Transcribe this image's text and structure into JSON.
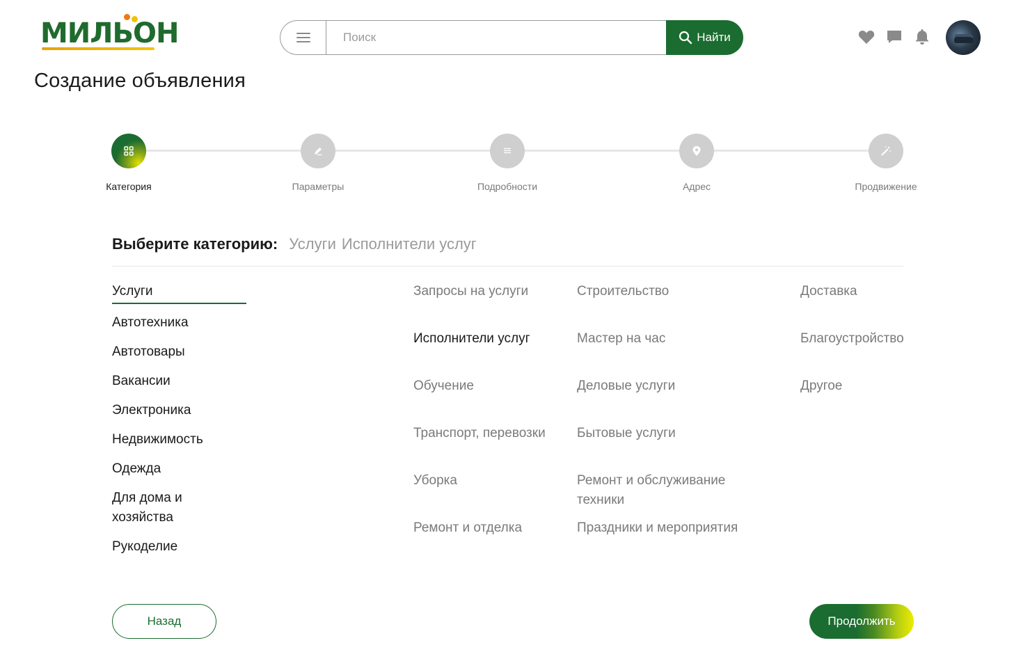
{
  "header": {
    "logo_text": "МИЛЬОН",
    "search": {
      "placeholder": "Поиск",
      "button_label": "Найти"
    },
    "icons": [
      "heart-icon",
      "chat-icon",
      "bell-icon"
    ],
    "colors": {
      "brand_green": "#1b6c30",
      "brand_yellow": "#f3c400",
      "icon_gray": "#8a8a8a"
    }
  },
  "page": {
    "title": "Создание объявления"
  },
  "stepper": {
    "steps": [
      {
        "label": "Категория",
        "icon": "grid-icon",
        "active": true
      },
      {
        "label": "Параметры",
        "icon": "pencil-icon",
        "active": false
      },
      {
        "label": "Подробности",
        "icon": "list-icon",
        "active": false
      },
      {
        "label": "Адрес",
        "icon": "location-pin-icon",
        "active": false
      },
      {
        "label": "Продвижение",
        "icon": "magic-wand-icon",
        "active": false
      }
    ]
  },
  "category": {
    "prompt": "Выберите категорию:",
    "breadcrumb": [
      "Услуги",
      "Исполнители услуг"
    ],
    "main": [
      "Услуги",
      "Автотехника",
      "Автотовары",
      "Вакансии",
      "Электроника",
      "Недвижимость",
      "Одежда",
      "Для дома и хозяйства",
      "Рукоделие"
    ],
    "selected_main": "Услуги",
    "sub_col1": [
      "Запросы на услуги",
      "Исполнители услуг",
      "Обучение",
      "Транспорт, перевозки",
      "Уборка",
      "Ремонт и отделка"
    ],
    "sub_col2": [
      "Строительство",
      "Мастер на час",
      "Деловые услуги",
      "Бытовые услуги",
      "Ремонт и обслуживание техники",
      "Праздники и мероприятия"
    ],
    "sub_col3": [
      "Доставка",
      "Благоустройство",
      "Другое"
    ],
    "selected_sub": "Исполнители услуг"
  },
  "actions": {
    "back_label": "Назад",
    "next_label": "Продолжить"
  }
}
